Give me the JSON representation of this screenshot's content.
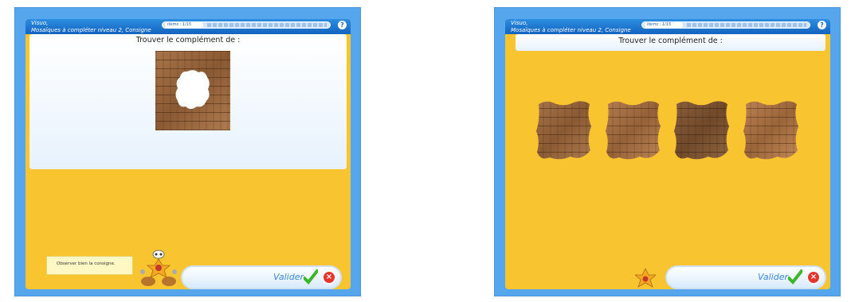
{
  "left": {
    "title_line1": "Visuo,",
    "title_line2": "Mosaïques à compléter niveau 2, Consigne",
    "progress_label": "Items : 1/15",
    "help_label": "?",
    "instruction": "Trouver le complément de :",
    "hint": "Observer bien la consigne.",
    "validate_label": "Valider",
    "cancel_label": "×"
  },
  "right": {
    "title_line1": "Visuo,",
    "title_line2": "Mosaïques à compléter niveau 2, Consigne",
    "progress_label": "Items : 1/15",
    "help_label": "?",
    "instruction": "Trouver le complément de :",
    "validate_label": "Valider",
    "cancel_label": "×",
    "choices": [
      "choice-1",
      "choice-2",
      "choice-3",
      "choice-4"
    ]
  },
  "colors": {
    "background_blue": "#55a6ec",
    "frame_yellow": "#f8c530",
    "header_blue": "#1463bf",
    "check_green": "#3db52c",
    "cancel_red": "#e2362e"
  },
  "icons": [
    "help-icon",
    "check-icon",
    "cancel-icon",
    "mascot-icon"
  ]
}
